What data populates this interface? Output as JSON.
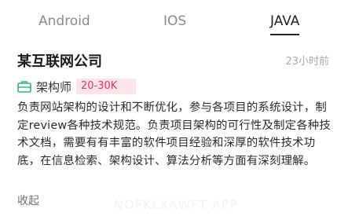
{
  "tabs": [
    {
      "label": "Android"
    },
    {
      "label": "IOS"
    },
    {
      "label": "JAVA"
    }
  ],
  "active_tab": "JAVA",
  "job": {
    "company": "某互联网公司",
    "posted_time": "23小时前",
    "role": "架构师",
    "salary": "20-30K",
    "description": "负责网站架构的设计和不断优化，参与各项目的系统设计，制定review各种技术规范。负责项目架构的可行性及制定各种技术文档，需要有有丰富的软件项目经验和深厚的软件技术功底，在信息检索、架构设计、算法分析等方面有深刻理解。",
    "collapse_label": "收起"
  },
  "watermark": "NOFKLXAWFT APP",
  "icons": {
    "role": "briefcase-icon"
  },
  "colors": {
    "accent_green": "#2bb673",
    "salary_text": "#e0315a",
    "salary_bg": "#fde3ea"
  }
}
